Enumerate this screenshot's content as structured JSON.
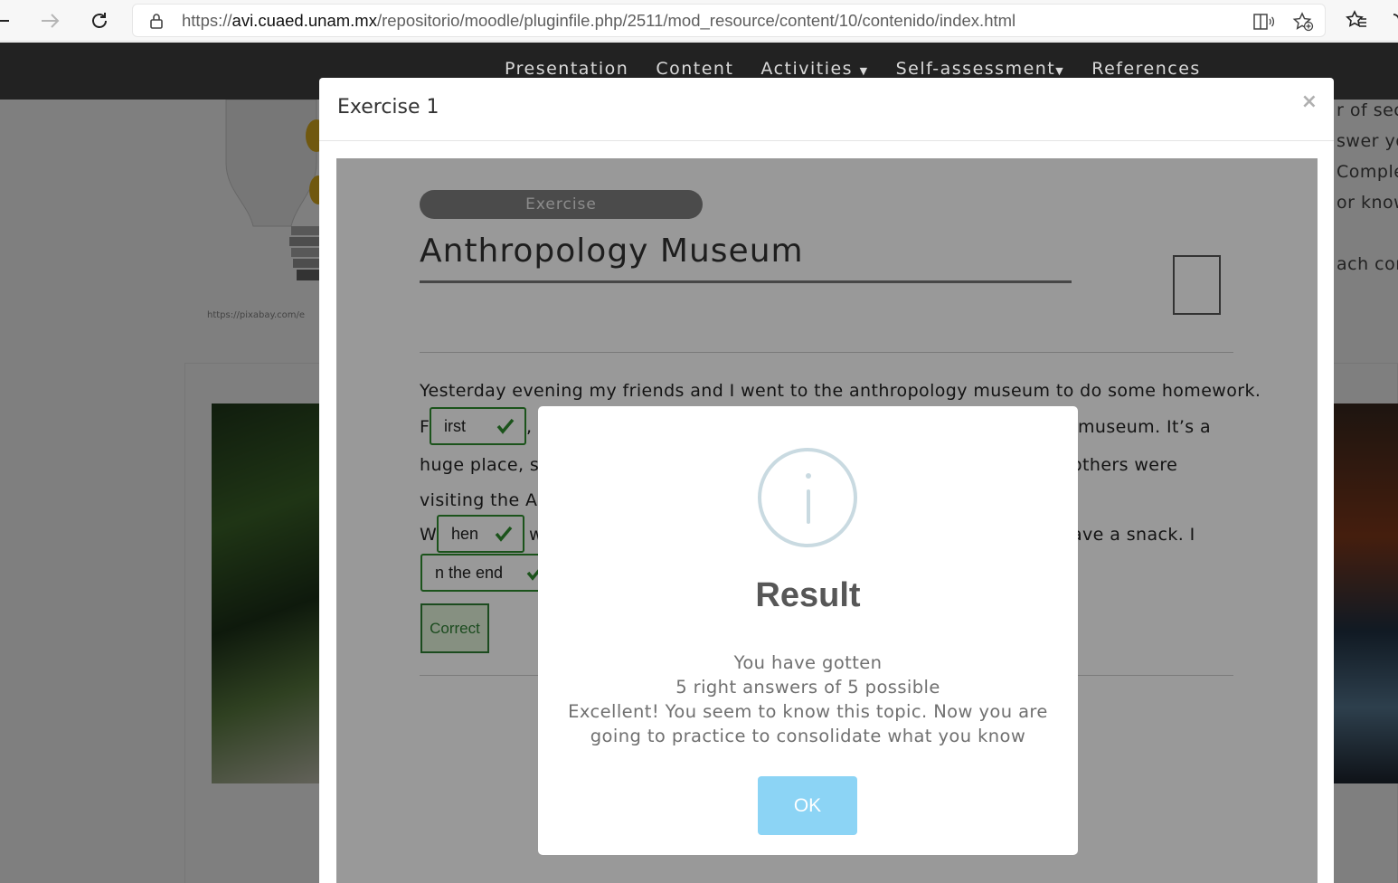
{
  "browser": {
    "url_scheme": "https://",
    "url_host": "avi.cuaed.unam.mx",
    "url_path": "/repositorio/moodle/pluginfile.php/2511/mod_resource/content/10/contenido/index.html",
    "icons": [
      "back-arrow-icon",
      "forward-arrow-icon",
      "reload-icon",
      "lock-icon",
      "read-aloud-icon",
      "add-favorite-icon",
      "favorites-icon",
      "more-icon"
    ]
  },
  "site_nav": {
    "items": [
      "Presentation",
      "Content",
      "Activities",
      "Self-assessment",
      "References"
    ]
  },
  "page": {
    "image_credit": "https://pixabay.com/e",
    "side_text": [
      "r of sec",
      "swer yo",
      "Comple",
      "or know",
      "ach cor"
    ]
  },
  "modal": {
    "title": "Exercise 1",
    "close_label": "×"
  },
  "exercise": {
    "pill_label": "Exercise",
    "title": "Anthropology Museum",
    "line1": "Yesterday evening my friends and I went to the anthropology museum to do some homework.",
    "line2_prefix": "F",
    "line2_after": ", w",
    "line2_right": "museum. It’s a",
    "line3_left": "huge place, so",
    "line3_right": "others were",
    "line4_left": "visiting the Az",
    "line5_prefix": "W",
    "line5_after": "w",
    "line5_right": "ave a snack. I",
    "answers": [
      "irst",
      "hen",
      "n the end"
    ],
    "correct_label": "Correct",
    "accent_color": "#2e8b2e"
  },
  "result": {
    "title": "Result",
    "line1": "You have gotten",
    "line2": "5 right answers of 5 possible",
    "line3": "Excellent! You seem to know this topic. Now you are",
    "line4": "going to practice to consolidate what you know",
    "ok_label": "OK",
    "ok_color": "#8cd4f5",
    "icon": "info-circle-icon",
    "score_right": 5,
    "score_possible": 5
  }
}
